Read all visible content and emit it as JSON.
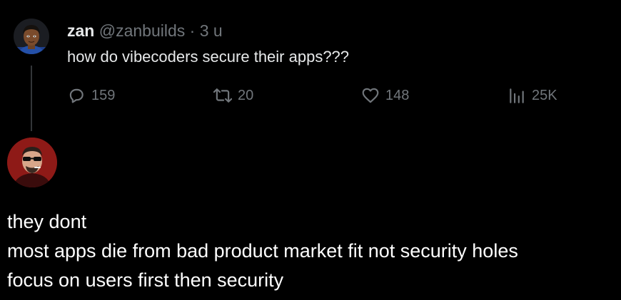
{
  "tweet": {
    "display_name": "zan",
    "handle": "@zanbuilds",
    "separator": "·",
    "time": "3 u",
    "text": "how do vibecoders secure their apps???",
    "actions": {
      "replies": "159",
      "retweets": "20",
      "likes": "148",
      "views": "25K"
    }
  },
  "reply": {
    "lines": [
      "they dont",
      "most apps die from bad product market fit not security holes",
      "focus on users first then security"
    ]
  },
  "icons": {
    "reply": "speech-bubble-icon",
    "retweet": "retweet-arrows-icon",
    "like": "heart-icon",
    "views": "bar-chart-icon"
  },
  "colors": {
    "background": "#000000",
    "text_primary": "#e7e9ea",
    "text_secondary": "#71767b",
    "thread_line": "#333639"
  }
}
